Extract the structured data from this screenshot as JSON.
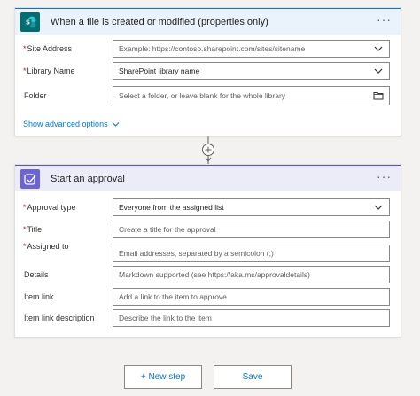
{
  "trigger": {
    "title": "When a file is created or modified (properties only)",
    "more": "···",
    "fields": [
      {
        "label": "Site Address",
        "required": "*",
        "value": "Example: https://contoso.sharepoint.com/sites/sitename",
        "control": "dropdown"
      },
      {
        "label": "Library Name",
        "required": "*",
        "value": "SharePoint library name",
        "control": "dropdown"
      },
      {
        "label": "Folder",
        "required": "",
        "value": "Select a folder, or leave blank for the whole library",
        "control": "folder"
      }
    ],
    "advanced_label": "Show advanced options"
  },
  "approval": {
    "title": "Start an approval",
    "more": "···",
    "fields": [
      {
        "label": "Approval type",
        "required": "*",
        "value": "Everyone from the assigned list",
        "control": "dropdown"
      },
      {
        "label": "Title",
        "required": "*",
        "value": "Create a title for the approval",
        "control": "text"
      },
      {
        "label": "Assigned to",
        "required": "*",
        "value": "Email addresses, separated by a semicolon (;)",
        "control": "text"
      },
      {
        "label": "Details",
        "required": "",
        "value": "Markdown supported (see https://aka.ms/approvaldetails)",
        "control": "text"
      },
      {
        "label": "Item link",
        "required": "",
        "value": "Add a link to the item to approve",
        "control": "text"
      },
      {
        "label": "Item link description",
        "required": "",
        "value": "Describe the link to the item",
        "control": "text"
      }
    ]
  },
  "footer": {
    "new_step_label": "+ New step",
    "save_label": "Save"
  },
  "colors": {
    "accent": "#0078d4",
    "sharepoint": "#036c70",
    "approvals": "#6b63d9",
    "required": "#a4262c"
  },
  "icons": {
    "trigger_logo": "sharepoint-logo-icon",
    "approval_logo": "approvals-logo-icon",
    "dropdown": "chevron-down-icon",
    "folder": "folder-icon",
    "connector": "add-step-plus-icon"
  }
}
